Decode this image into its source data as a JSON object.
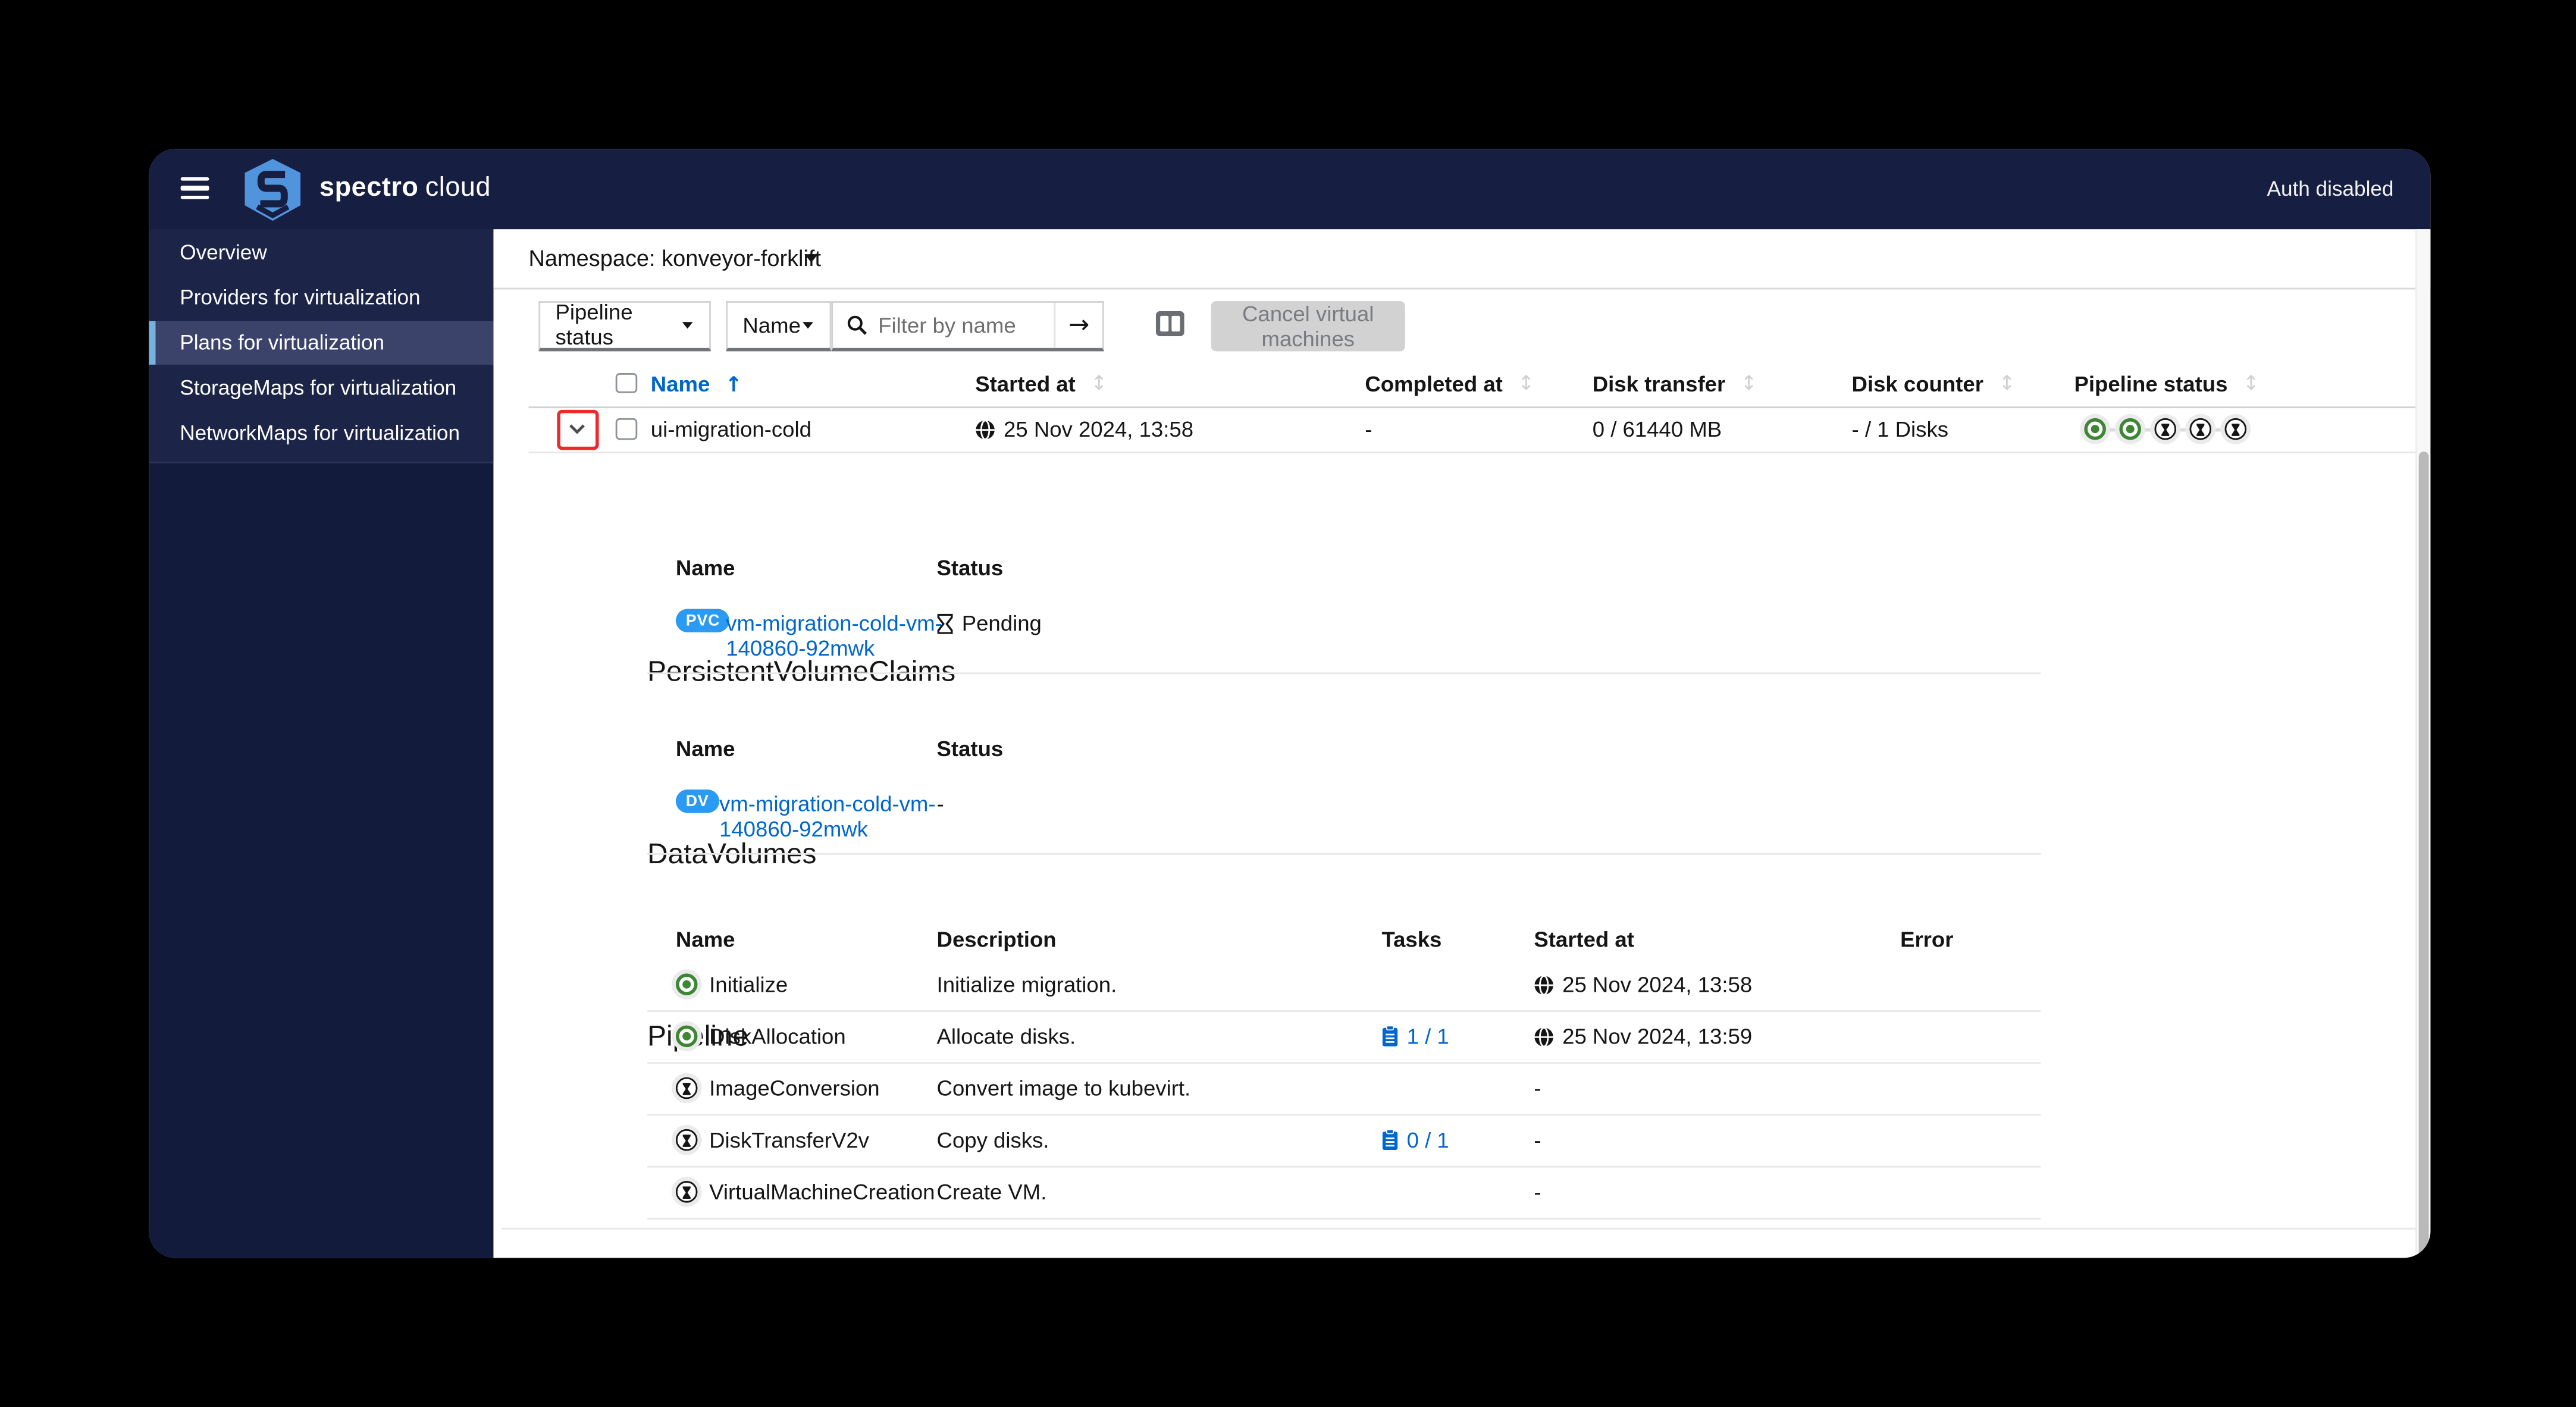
{
  "topbar": {
    "brand_bold": "spectro",
    "brand_light": "cloud",
    "auth_status": "Auth disabled"
  },
  "sidebar": {
    "items": [
      {
        "label": "Overview",
        "active": false
      },
      {
        "label": "Providers for virtualization",
        "active": false
      },
      {
        "label": "Plans for virtualization",
        "active": true
      },
      {
        "label": "StorageMaps for virtualization",
        "active": false
      },
      {
        "label": "NetworkMaps for virtualization",
        "active": false
      }
    ]
  },
  "namespace_bar": {
    "label": "Namespace: konveyor-forklift"
  },
  "toolbar": {
    "filter_type_label": "Pipeline status",
    "filter_field_label": "Name",
    "search_placeholder": "Filter by name",
    "arrow_glyph": "→",
    "cancel_label": "Cancel virtual machines"
  },
  "plans_table": {
    "headers": [
      "Name",
      "Started at",
      "Completed at",
      "Disk transfer",
      "Disk counter",
      "Pipeline status"
    ],
    "sort_glyph": "↕",
    "name_sort_glyph": "↑",
    "row": {
      "name": "ui-migration-cold",
      "started_at": "25 Nov 2024, 13:58",
      "completed_at": "-",
      "disk_transfer": "0 / 61440 MB",
      "disk_counter": "- / 1 Disks",
      "pipeline_steps": [
        "success",
        "success",
        "pending",
        "pending",
        "pending"
      ]
    }
  },
  "details": {
    "pvc": {
      "title": "PersistentVolumeClaims",
      "headers": [
        "Name",
        "Status"
      ],
      "badge": "PVC",
      "name_line1": "vm-migration-cold-vm-",
      "name_line2": "140860-92mwk",
      "status": "Pending"
    },
    "dv": {
      "title": "DataVolumes",
      "headers": [
        "Name",
        "Status"
      ],
      "badge": "DV",
      "name_line1": "vm-migration-cold-vm-",
      "name_line2": "140860-92mwk",
      "status": "-"
    },
    "pipeline": {
      "title": "Pipeline",
      "headers": [
        "Name",
        "Description",
        "Tasks",
        "Started at",
        "Error"
      ],
      "rows": [
        {
          "state": "success",
          "name": "Initialize",
          "description": "Initialize migration.",
          "tasks": "",
          "started_at": "25 Nov 2024, 13:58",
          "error": ""
        },
        {
          "state": "success",
          "name": "DiskAllocation",
          "description": "Allocate disks.",
          "tasks": "1 / 1",
          "started_at": "25 Nov 2024, 13:59",
          "error": ""
        },
        {
          "state": "pending",
          "name": "ImageConversion",
          "description": "Convert image to kubevirt.",
          "tasks": "",
          "started_at": "-",
          "error": ""
        },
        {
          "state": "pending",
          "name": "DiskTransferV2v",
          "description": "Copy disks.",
          "tasks": "0 / 1",
          "started_at": "-",
          "error": ""
        },
        {
          "state": "pending",
          "name": "VirtualMachineCreation",
          "description": "Create VM.",
          "tasks": "",
          "started_at": "-",
          "error": ""
        }
      ]
    }
  },
  "colors": {
    "topbar_navy": "#161e41",
    "sidebar_navy": "#1c2548",
    "sidebar_active": "#3b436a",
    "sidebar_accent": "#76b2e0",
    "link_blue": "#0066cc",
    "badge_blue": "#2b9af3",
    "success_green": "#3e8635",
    "annotation_red": "#ec2a2e",
    "disabled_gray": "#d2d2d2"
  }
}
